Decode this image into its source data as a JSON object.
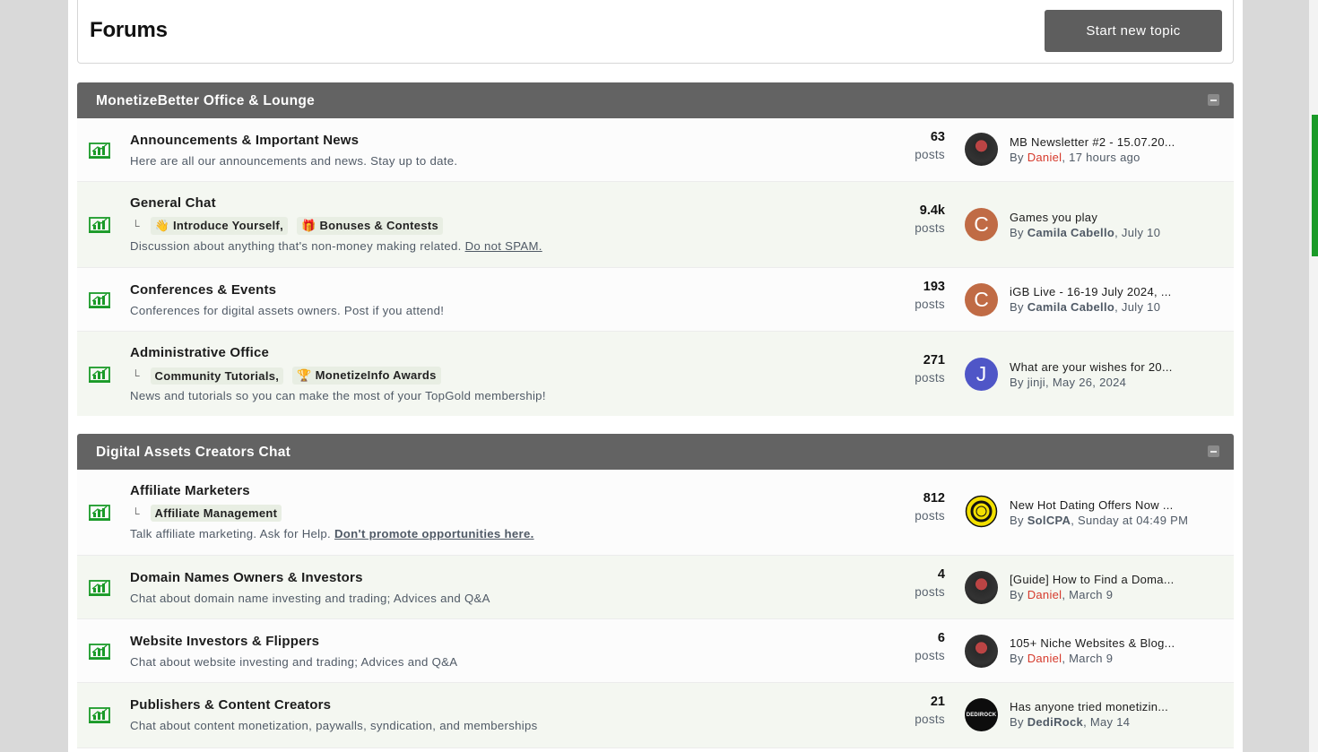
{
  "header": {
    "title": "Forums",
    "new_topic_label": "Start new topic"
  },
  "colors": {
    "header_bar": "#636363",
    "accent_green": "#1a9a28",
    "user_red": "#d63a2c"
  },
  "categories": [
    {
      "title": "MonetizeBetter Office & Lounge",
      "forums": [
        {
          "title": "Announcements & Important News",
          "description": "Here are all our announcements and news. Stay up to date.",
          "posts": "63",
          "posts_label": "posts",
          "last_topic": "MB Newsletter #2 - 15.07.20...",
          "by": "By",
          "user": "Daniel",
          "time": ", 17 hours ago"
        },
        {
          "title": "General Chat",
          "subforums": [
            {
              "emoji": "👋",
              "label": "Introduce Yourself,"
            },
            {
              "emoji": "🎁",
              "label": "Bonuses & Contests"
            }
          ],
          "description": "Discussion about anything that's non-money making related.",
          "desc_link": "Do not SPAM.",
          "posts": "9.4k",
          "posts_label": "posts",
          "last_topic": "Games you play",
          "by": "By",
          "user": "Camila Cabello",
          "time": ", July 10",
          "avatar_letter": "C"
        },
        {
          "title": "Conferences & Events",
          "description": "Conferences for digital assets owners. Post if you attend!",
          "posts": "193",
          "posts_label": "posts",
          "last_topic": "iGB Live - 16-19 July 2024, ...",
          "by": "By",
          "user": "Camila Cabello",
          "time": ", July 10",
          "avatar_letter": "C"
        },
        {
          "title": "Administrative Office",
          "subforums": [
            {
              "emoji": "",
              "label": "Community Tutorials,"
            },
            {
              "emoji": "🏆",
              "label": "MonetizeInfo Awards"
            }
          ],
          "description": "News and tutorials so you can make the most of your TopGold membership!",
          "posts": "271",
          "posts_label": "posts",
          "last_topic": "What are your wishes for 20...",
          "by": "By",
          "user": "jinji",
          "time": ", May 26, 2024",
          "avatar_letter": "J"
        }
      ]
    },
    {
      "title": "Digital Assets Creators Chat",
      "forums": [
        {
          "title": "Affiliate Marketers",
          "subforums": [
            {
              "emoji": "",
              "label": "Affiliate Management"
            }
          ],
          "description": "Talk affiliate marketing. Ask for Help.",
          "desc_link": "Don't promote opportunities here.",
          "posts": "812",
          "posts_label": "posts",
          "last_topic": "New Hot Dating Offers Now ...",
          "by": "By",
          "user": "SolCPA",
          "time": ", Sunday at 04:49 PM"
        },
        {
          "title": "Domain Names Owners & Investors",
          "description": "Chat about domain name investing and trading; Advices and Q&A",
          "posts": "4",
          "posts_label": "posts",
          "last_topic": "[Guide] How to Find a Doma...",
          "by": "By",
          "user": "Daniel",
          "time": ", March 9"
        },
        {
          "title": "Website Investors & Flippers",
          "description": "Chat about website investing and trading; Advices and Q&A",
          "posts": "6",
          "posts_label": "posts",
          "last_topic": "105+ Niche Websites & Blog...",
          "by": "By",
          "user": "Daniel",
          "time": ", March 9"
        },
        {
          "title": "Publishers & Content Creators",
          "description": "Chat about content monetization, paywalls, syndication, and memberships",
          "posts": "21",
          "posts_label": "posts",
          "last_topic": "Has anyone tried monetizin...",
          "by": "By",
          "user": "DediRock",
          "time": ", May 14",
          "avatar_text": "DEDIROCK"
        }
      ]
    }
  ]
}
